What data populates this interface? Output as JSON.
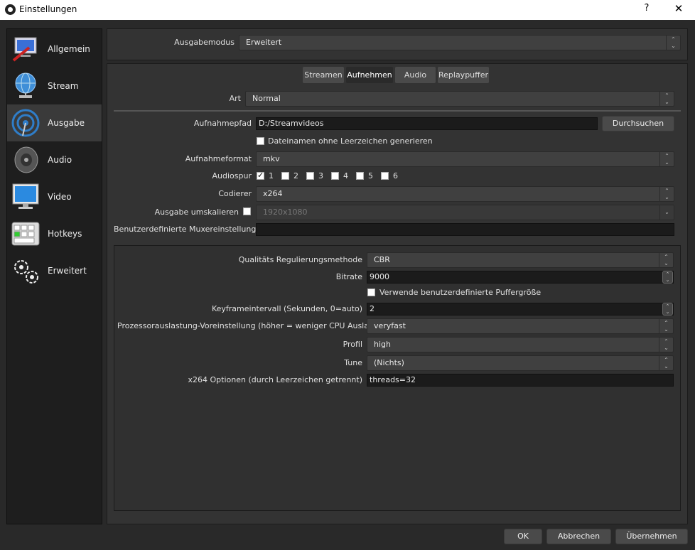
{
  "window": {
    "title": "Einstellungen",
    "help": "?",
    "close": "✕"
  },
  "sidebar": {
    "items": [
      {
        "label": "Allgemein"
      },
      {
        "label": "Stream"
      },
      {
        "label": "Ausgabe"
      },
      {
        "label": "Audio"
      },
      {
        "label": "Video"
      },
      {
        "label": "Hotkeys"
      },
      {
        "label": "Erweitert"
      }
    ]
  },
  "output_mode": {
    "label": "Ausgabemodus",
    "value": "Erweitert"
  },
  "tabs": [
    {
      "label": "Streamen"
    },
    {
      "label": "Aufnehmen"
    },
    {
      "label": "Audio"
    },
    {
      "label": "Replaypuffer"
    }
  ],
  "recording": {
    "type_label": "Art",
    "type_value": "Normal",
    "path_label": "Aufnahmepfad",
    "path_value": "D:/Streamvideos",
    "browse": "Durchsuchen",
    "nospace_label": "Dateinamen ohne Leerzeichen generieren",
    "format_label": "Aufnahmeformat",
    "format_value": "mkv",
    "audiotrack_label": "Audiospur",
    "tracks": [
      {
        "label": "1",
        "checked": true
      },
      {
        "label": "2",
        "checked": false
      },
      {
        "label": "3",
        "checked": false
      },
      {
        "label": "4",
        "checked": false
      },
      {
        "label": "5",
        "checked": false
      },
      {
        "label": "6",
        "checked": false
      }
    ],
    "encoder_label": "Codierer",
    "encoder_value": "x264",
    "rescale_label": "Ausgabe umskalieren",
    "rescale_value": "1920x1080",
    "muxer_label": "Benutzerdefinierte Muxereinstellungen",
    "muxer_value": ""
  },
  "encoder": {
    "rate_control_label": "Qualitäts Regulierungsmethode",
    "rate_control_value": "CBR",
    "bitrate_label": "Bitrate",
    "bitrate_value": "9000",
    "custom_buffer_label": "Verwende benutzerdefinierte Puffergröße",
    "keyframe_label": "Keyframeintervall (Sekunden, 0=auto)",
    "keyframe_value": "2",
    "preset_label": "Prozessorauslastung-Voreinstellung (höher = weniger CPU Auslastung)",
    "preset_value": "veryfast",
    "profile_label": "Profil",
    "profile_value": "high",
    "tune_label": "Tune",
    "tune_value": "(Nichts)",
    "x264opts_label": "x264 Optionen (durch Leerzeichen getrennt)",
    "x264opts_value": "threads=32"
  },
  "footer": {
    "ok": "OK",
    "cancel": "Abbrechen",
    "apply": "Übernehmen"
  }
}
